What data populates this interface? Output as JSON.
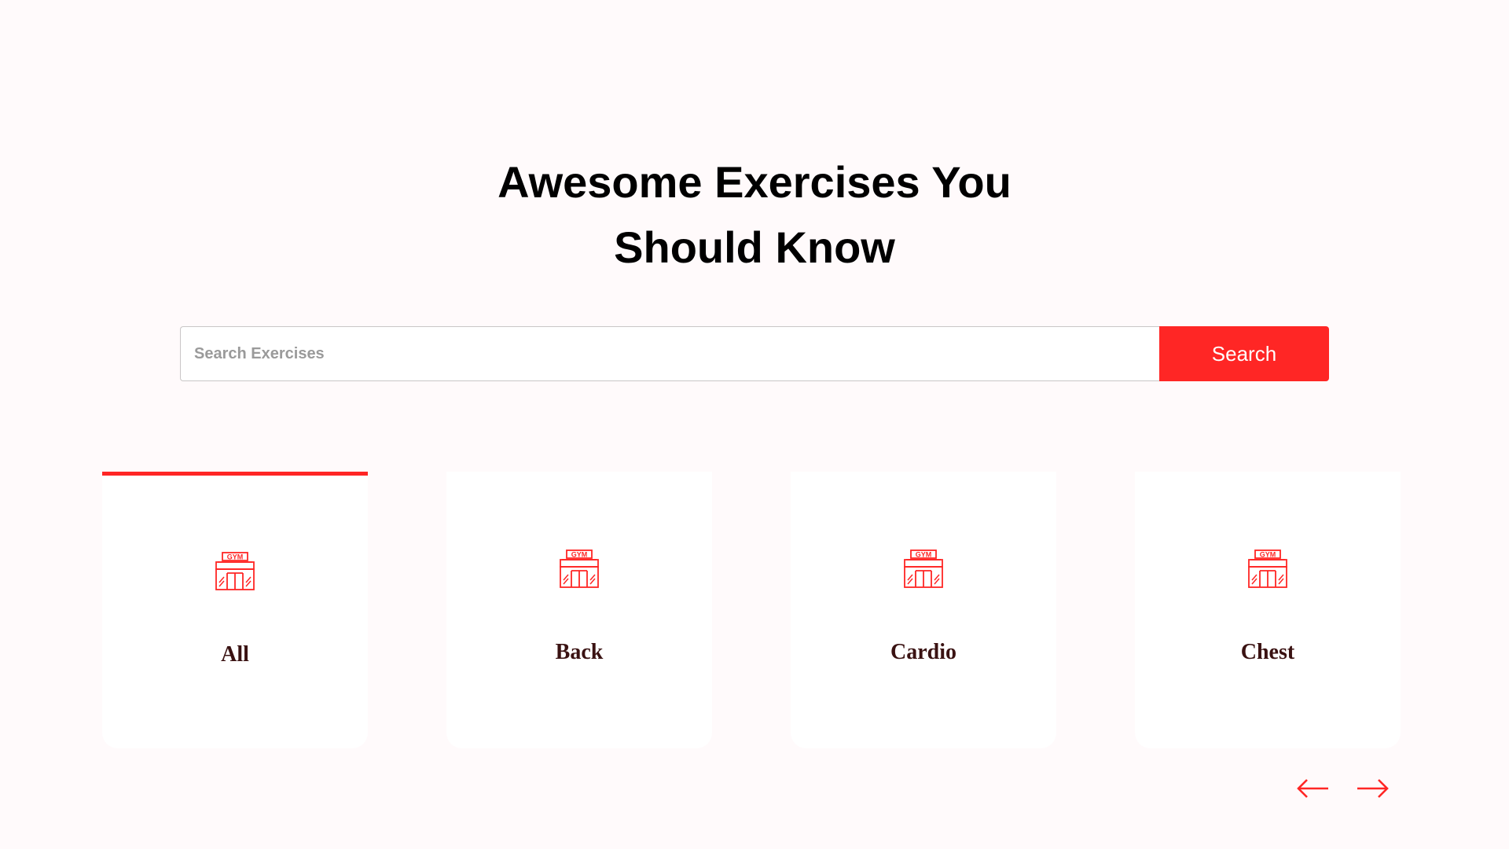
{
  "heading": {
    "line1": "Awesome Exercises You",
    "line2": "Should Know"
  },
  "search": {
    "placeholder": "Search Exercises",
    "value": "",
    "button_label": "Search"
  },
  "categories": [
    {
      "label": "All",
      "icon": "gym-icon",
      "active": true
    },
    {
      "label": "Back",
      "icon": "gym-icon",
      "active": false
    },
    {
      "label": "Cardio",
      "icon": "gym-icon",
      "active": false
    },
    {
      "label": "Chest",
      "icon": "gym-icon",
      "active": false
    }
  ],
  "navigation": {
    "prev_icon": "arrow-left-icon",
    "next_icon": "arrow-right-icon"
  },
  "colors": {
    "accent": "#ff2625",
    "background": "#fffafb",
    "card": "#ffffff",
    "label_text": "#3a1212"
  }
}
